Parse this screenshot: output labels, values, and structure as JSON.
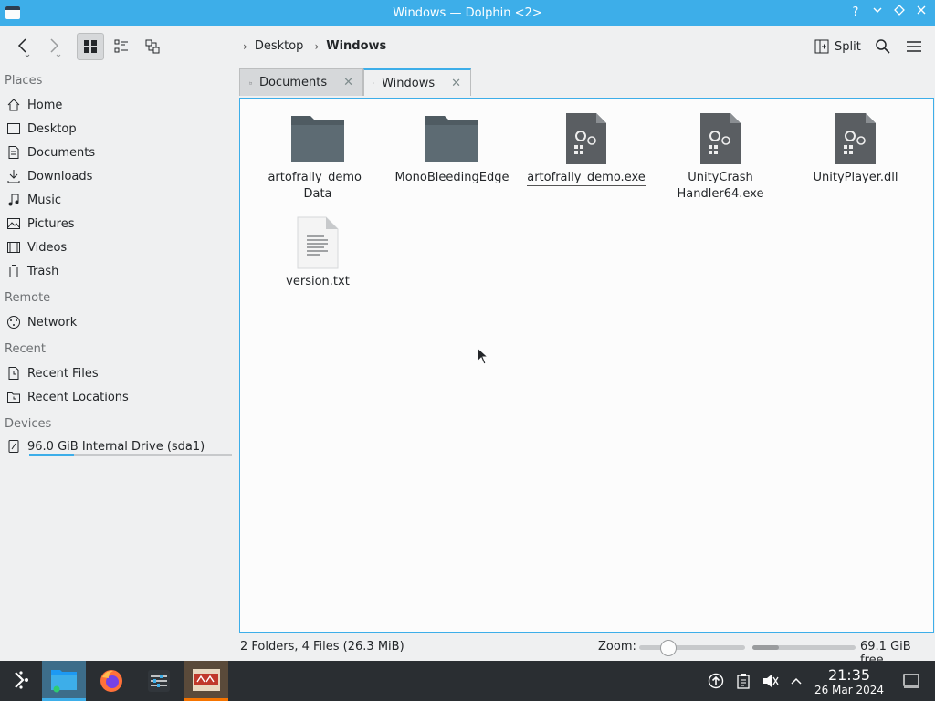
{
  "window": {
    "title": "Windows — Dolphin <2>"
  },
  "titlebar_buttons": [
    "help-icon",
    "minimize-icon",
    "maximize-icon",
    "close-icon"
  ],
  "toolbar": {
    "breadcrumbs": [
      "Desktop",
      "Windows"
    ],
    "split_label": "Split"
  },
  "sidebar": {
    "sections": {
      "places": "Places",
      "remote": "Remote",
      "recent": "Recent",
      "devices": "Devices"
    },
    "places": [
      {
        "label": "Home",
        "icon": "home-icon"
      },
      {
        "label": "Desktop",
        "icon": "desktop-icon"
      },
      {
        "label": "Documents",
        "icon": "documents-icon"
      },
      {
        "label": "Downloads",
        "icon": "downloads-icon"
      },
      {
        "label": "Music",
        "icon": "music-icon"
      },
      {
        "label": "Pictures",
        "icon": "pictures-icon"
      },
      {
        "label": "Videos",
        "icon": "videos-icon"
      },
      {
        "label": "Trash",
        "icon": "trash-icon"
      }
    ],
    "remote": [
      {
        "label": "Network",
        "icon": "network-icon"
      }
    ],
    "recent": [
      {
        "label": "Recent Files",
        "icon": "recent-files-icon"
      },
      {
        "label": "Recent Locations",
        "icon": "recent-locations-icon"
      }
    ],
    "devices": [
      {
        "label": "96.0 GiB Internal Drive (sda1)",
        "icon": "drive-icon",
        "usage_fraction": 0.22
      }
    ]
  },
  "tabs": [
    {
      "label": "Documents",
      "active": false
    },
    {
      "label": "Windows",
      "active": true
    }
  ],
  "files": [
    {
      "name": "artofrally_demo_\nData",
      "type": "folder"
    },
    {
      "name": "MonoBleedingEdge",
      "type": "folder"
    },
    {
      "name": "artofrally_demo.exe",
      "type": "executable"
    },
    {
      "name": "UnityCrash\nHandler64.exe",
      "type": "executable"
    },
    {
      "name": "UnityPlayer.dll",
      "type": "library"
    },
    {
      "name": "version.txt",
      "type": "text"
    }
  ],
  "statusbar": {
    "summary": "2 Folders, 4 Files (26.3 MiB)",
    "zoom_label": "Zoom:",
    "zoom_fraction": 0.2,
    "free_space": "69.1 GiB free",
    "free_fraction": 0.26
  },
  "taskbar": {
    "time": "21:35",
    "date": "26 Mar 2024"
  },
  "colors": {
    "accent": "#3daee9",
    "folder": "#5d6b73",
    "taskbar": "#2a2e32"
  }
}
